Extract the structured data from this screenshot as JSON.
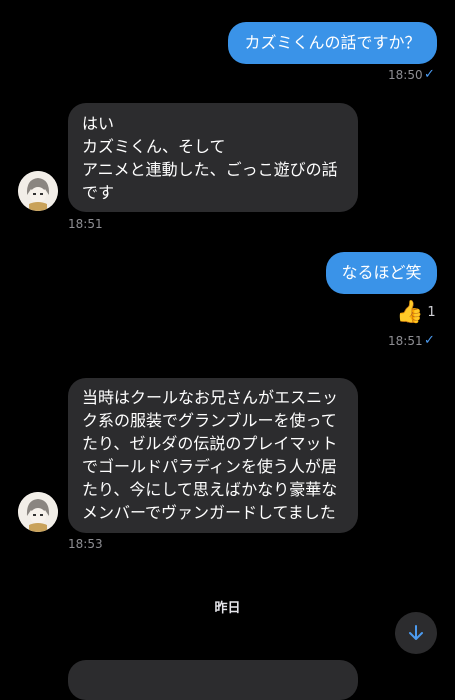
{
  "messages": {
    "m1": {
      "text": "カズミくんの話ですか？",
      "time": "18:50",
      "status": "✓"
    },
    "m2": {
      "text": "はい\nカズミくん、そして\nアニメと連動した、ごっこ遊びの話\nです",
      "time": "18:51"
    },
    "m3": {
      "text": "なるほど笑",
      "time": "18:51",
      "status": "✓",
      "reaction_emoji": "👍",
      "reaction_count": "1"
    },
    "m4": {
      "text": "当時はクールなお兄さんがエスニッ\nク系の服装でグランブルーを使って\nたり、ゼルダの伝説のプレイマット\nでゴールドパラディンを使う人が居\nたり、今にして思えばかなり豪華な\nメンバーでヴァンガードしてました",
      "time": "18:53"
    }
  },
  "date_separator": "昨日",
  "icons": {
    "scroll_down": "arrow-down-icon",
    "reaction": "thumbs-up-icon",
    "read": "check-icon"
  },
  "colors": {
    "outgoing": "#3a93e8",
    "incoming": "#2c2c2e",
    "background": "#000000",
    "check": "#4c9bf0"
  }
}
